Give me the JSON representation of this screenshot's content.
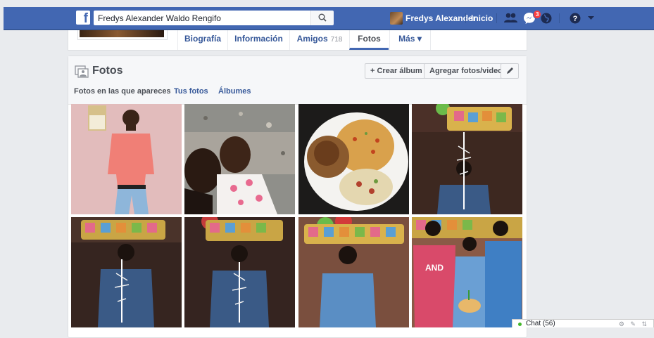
{
  "topbar": {
    "logo_letter": "f",
    "search_value": "Fredys Alexander Waldo Rengifo",
    "user_name": "Fredys Alexander",
    "home_label": "Inicio",
    "messages_badge": "3"
  },
  "profile_tabs": [
    {
      "label": "Biografía"
    },
    {
      "label": "Información"
    },
    {
      "label": "Amigos",
      "count": "718"
    },
    {
      "label": "Fotos"
    },
    {
      "label": "Más ▾"
    }
  ],
  "photos": {
    "title": "Fotos",
    "create_album_label": "+ Crear álbum",
    "add_photos_label": "Agregar fotos/video",
    "subtabs": [
      "Fotos en las que apareces",
      "Tus fotos",
      "Álbumes"
    ]
  },
  "chat": {
    "label": "Chat (56)"
  },
  "colors": {
    "brand": "#4267b2",
    "link": "#365899",
    "background": "#e9ebee"
  },
  "icons": [
    "search-icon",
    "friends-icon",
    "messages-icon",
    "globe-icon",
    "help-icon",
    "chevron-down-icon",
    "photo-album-icon",
    "pencil-icon",
    "settings-icon"
  ]
}
